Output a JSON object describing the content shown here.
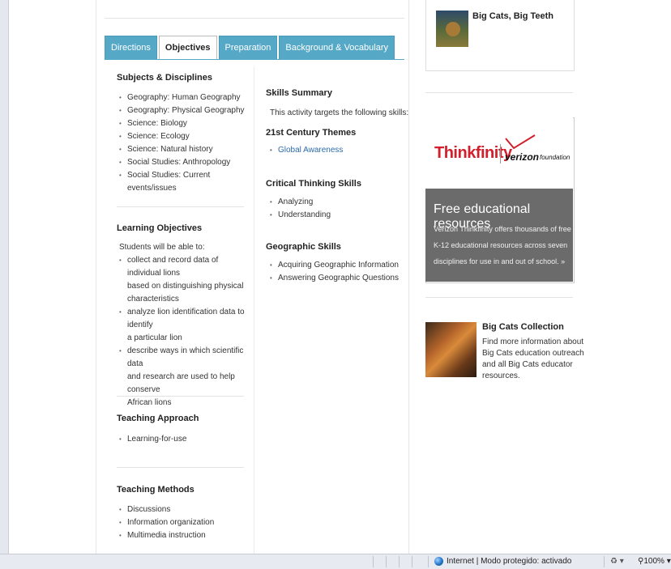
{
  "tabs": [
    {
      "label": "Directions"
    },
    {
      "label": "Objectives"
    },
    {
      "label": "Preparation"
    },
    {
      "label": "Background & Vocabulary"
    }
  ],
  "subjects": {
    "heading": "Subjects & Disciplines",
    "items": [
      "Geography: Human Geography",
      "Geography: Physical Geography",
      "Science: Biology",
      "Science: Ecology",
      "Science: Natural history",
      "Social Studies: Anthropology",
      "Social Studies: Current events/issues"
    ]
  },
  "learning": {
    "heading": "Learning Objectives",
    "intro": "Students will be able to:",
    "items": [
      [
        "collect and record data of individual lions",
        "based on distinguishing physical",
        "characteristics"
      ],
      [
        "analyze lion identification data to identify",
        "a particular lion"
      ],
      [
        "describe ways in which scientific data",
        "and research are used to help conserve",
        "African lions"
      ]
    ]
  },
  "approach": {
    "heading": "Teaching Approach",
    "items": [
      "Learning-for-use"
    ]
  },
  "methods": {
    "heading": "Teaching Methods",
    "items": [
      "Discussions",
      "Information organization",
      "Multimedia instruction"
    ]
  },
  "skills": {
    "heading": "Skills Summary",
    "intro": "This activity targets the following skills:",
    "themes_heading": "21st Century Themes",
    "themes": [
      "Global Awareness"
    ],
    "critical_heading": "Critical Thinking Skills",
    "critical": [
      "Analyzing",
      "Understanding"
    ],
    "geo_heading": "Geographic Skills",
    "geo": [
      "Acquiring Geographic Information",
      "Answering Geographic Questions"
    ]
  },
  "sidebar": {
    "card_title": "Big Cats, Big Teeth",
    "ad": {
      "logo_text": "Thinkfinity",
      "partner": "verizon",
      "partner_suffix": "foundation",
      "headline": "Free educational resources",
      "body": [
        "Verizon Thinkfinity offers thousands of free",
        "K-12 educational resources across seven",
        "disciplines for use in and out of school. »"
      ]
    },
    "collection": {
      "title": "Big Cats Collection",
      "body": [
        "Find more information about",
        "Big Cats education outreach",
        "and all Big Cats educator",
        "resources."
      ]
    }
  },
  "statusbar": {
    "zone": "Internet | Modo protegido: activado",
    "zoom": "100%"
  },
  "colors": {
    "tab_blue": "#55a8c6",
    "link_blue": "#2b6cab",
    "ad_grey": "#6b6b6b",
    "thinkfinity_red": "#d21f2b"
  }
}
